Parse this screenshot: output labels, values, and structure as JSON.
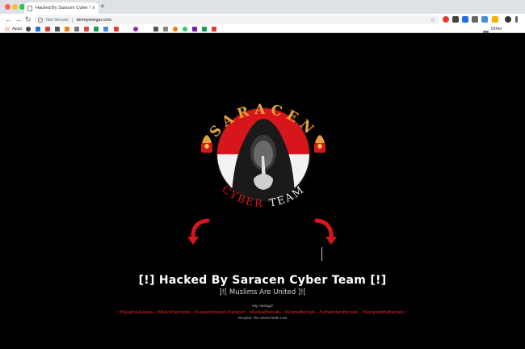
{
  "browser": {
    "tab_title": "Hacked By Saracen Cyber Te...",
    "tab_close": "×",
    "new_tab": "+",
    "security_label": "Not Secure",
    "url": "dennysiregar.com",
    "apps_label": "Apps",
    "other_bookmarks_label": "Other Bookmarks",
    "icons": [
      "back-arrow-icon",
      "forward-arrow-icon",
      "reload-icon",
      "info-icon",
      "star-icon",
      "apps-grid-icon",
      "folder-icon"
    ]
  },
  "page": {
    "logo_letters_top": [
      "S",
      "A",
      "R",
      "A",
      "C",
      "E",
      "N"
    ],
    "logo_word_cyber": "CYBER",
    "logo_word_team": "TEAM",
    "headline": "[!] Hacked By Saracen Cyber Team [!]",
    "subline": "]![ Muslims Are United ]![",
    "hashtag_label": "\\My Hastagz/",
    "hashtags": ".::#SyiahVsAswaja - #RkiVsPancasila - #LaskarKristusVsSaracen - #RakyatBersatu - #UlamaBersatu - #UmatIslamBersatu - #SaracenMtaBersatu ::.",
    "exploit_text": "#Exploit The World With Use",
    "colors": {
      "background": "#000000",
      "hashtag_red": "#e8262a",
      "logo_red": "#d7161c",
      "logo_orange": "#e8a33a"
    }
  }
}
